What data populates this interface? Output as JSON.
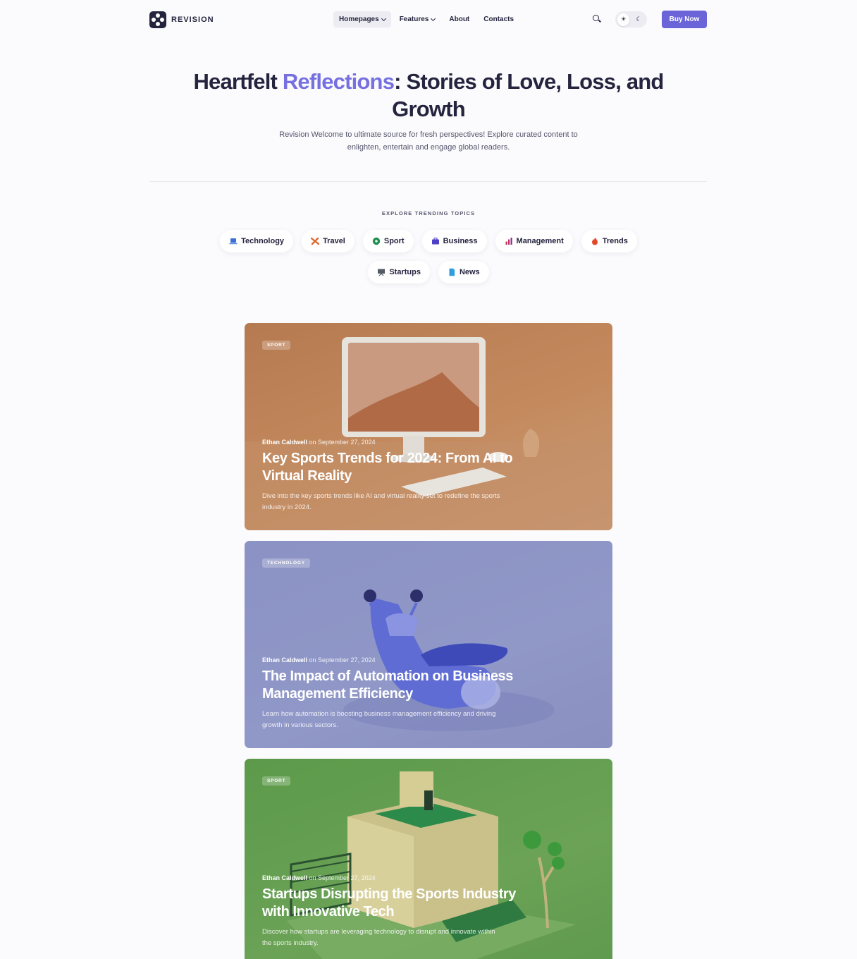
{
  "header": {
    "logo_text": "REVISION",
    "nav": [
      {
        "label": "Homepages",
        "dropdown": true,
        "active": true
      },
      {
        "label": "Features",
        "dropdown": true,
        "active": false
      },
      {
        "label": "About",
        "dropdown": false,
        "active": false
      },
      {
        "label": "Contacts",
        "dropdown": false,
        "active": false
      }
    ],
    "search_icon": "search-icon",
    "theme_toggle": {
      "light_icon": "sun-icon",
      "dark_icon": "moon-icon",
      "selected": "light"
    },
    "buy_label": "Buy Now"
  },
  "hero": {
    "title_before": "Heartfelt ",
    "title_accent": "Reflections",
    "title_after": ": Stories of Love, Loss, and Growth",
    "subtitle": "Revision Welcome to ultimate source for fresh perspectives! Explore curated content to enlighten, entertain and engage global readers."
  },
  "topics": {
    "heading": "EXPLORE TRENDING TOPICS",
    "items": [
      {
        "label": "Technology",
        "icon": "laptop-icon"
      },
      {
        "label": "Travel",
        "icon": "airplane-icon"
      },
      {
        "label": "Sport",
        "icon": "ball-icon"
      },
      {
        "label": "Business",
        "icon": "briefcase-icon"
      },
      {
        "label": "Management",
        "icon": "bar-chart-icon"
      },
      {
        "label": "Trends",
        "icon": "fire-icon"
      },
      {
        "label": "Startups",
        "icon": "presentation-icon"
      },
      {
        "label": "News",
        "icon": "document-icon"
      }
    ]
  },
  "posts": [
    {
      "category": "SPORT",
      "author": "Ethan Caldwell",
      "date_prefix": " on ",
      "date": "September 27, 2024",
      "title": "Key Sports Trends for 2024: From AI to Virtual Reality",
      "excerpt": "Dive into the key sports trends like AI and virtual reality set to redefine the sports industry in 2024."
    },
    {
      "category": "TECHNOLOGY",
      "author": "Ethan Caldwell",
      "date_prefix": " on ",
      "date": "September 27, 2024",
      "title": "The Impact of Automation on Business Management Efficiency",
      "excerpt": "Learn how automation is boosting business management efficiency and driving growth in various sectors."
    },
    {
      "category": "SPORT",
      "author": "Ethan Caldwell",
      "date_prefix": " on ",
      "date": "September 27, 2024",
      "title": "Startups Disrupting the Sports Industry with Innovative Tech",
      "excerpt": "Discover how startups are leveraging technology to disrupt and innovate within the sports industry."
    }
  ],
  "colors": {
    "accent": "#7670e0",
    "button": "#6b64d9",
    "text_dark": "#25243f",
    "card_sport": "#c48a5e",
    "card_technology": "#9098c8",
    "card_green": "#6ba256"
  }
}
